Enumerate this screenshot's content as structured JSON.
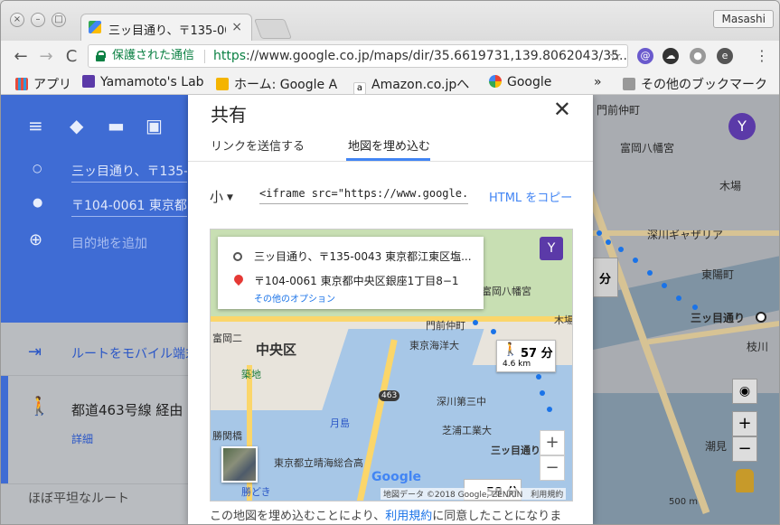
{
  "browser": {
    "tab_title": "三ッ目通り、〒135-00",
    "tab_close": "×",
    "user": "Masashi",
    "secure_label": "保護された通信",
    "url_scheme": "https",
    "url_rest": "://www.google.co.jp/maps/dir/35.6619731,139.8062043/35....",
    "star": "☆",
    "back": "←",
    "forward": "→",
    "reload": "C",
    "bookmarks": [
      {
        "label": "アプリ"
      },
      {
        "label": "Yamamoto's Lab"
      },
      {
        "label": "ホーム: Google A"
      },
      {
        "label": "Amazon.co.jpへ"
      },
      {
        "label": "Google"
      }
    ],
    "bookmarks_more": "»",
    "other_bookmarks": "その他のブックマーク"
  },
  "panel": {
    "origin": "三ッ目通り、〒135-0",
    "destination": "〒104-0061 東京都",
    "add_destination": "目的地を追加",
    "send_to_mobile": "ルートをモバイル端末",
    "route_title": "都道463号線 経由",
    "route_detail": "詳細",
    "route_note": "ほぼ平坦なルート"
  },
  "right_map": {
    "labels": [
      "門前仲町",
      "富岡八幡宮",
      "木場",
      "深川ギャザリア",
      "三ッ目通り",
      "東陽町",
      "枝川",
      "潮見",
      "500 m"
    ],
    "route_time_fragment": "分"
  },
  "share_dialog": {
    "title": "共有",
    "close": "✕",
    "tabs": [
      {
        "label": "リンクを送信する",
        "active": false
      },
      {
        "label": "地図を埋め込む",
        "active": true
      }
    ],
    "size_label": "小",
    "embed_code": "<iframe src=\"https://www.google.com/m",
    "copy_html": "HTML をコピー",
    "preview": {
      "origin": "三ッ目通り、〒135-0043 東京都江東区塩...",
      "destination": "〒104-0061 東京都中央区銀座1丁目8−1",
      "more_options": "その他のオプション",
      "walk_time": "57 分",
      "walk_distance": "4.6 km",
      "walk_time_2": "58 分",
      "labels": [
        "中央区",
        "築地",
        "月島",
        "勝どき",
        "東京海洋大",
        "深川第三中",
        "芝浦工業大",
        "東京都立晴海総合高",
        "勝関橋",
        "門前仲町",
        "富岡八幡宮",
        "富岡二",
        "三ッ目通り",
        "木場"
      ],
      "road_badge": "463",
      "attribution": "地図データ ©2018 Google, ZENRIN　利用規約",
      "google": "Google"
    },
    "footer_pre": "この地図を埋め込むことにより、",
    "footer_link": "利用規約",
    "footer_post": "に同意したことになりま"
  },
  "colors": {
    "maps_blue": "#4285f4",
    "secure_green": "#0b8043"
  }
}
